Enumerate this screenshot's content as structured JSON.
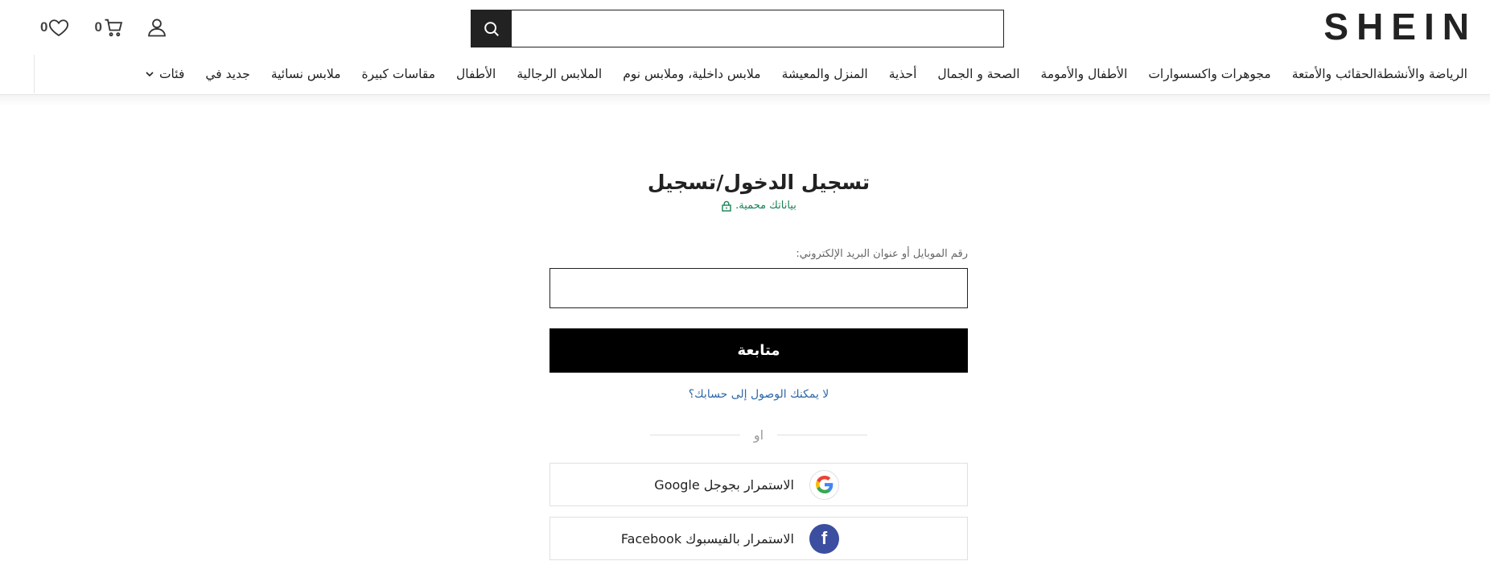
{
  "header": {
    "logo": "SHEIN",
    "search": {
      "placeholder": "",
      "value": ""
    },
    "wishlist_count": "0",
    "cart_count": "0"
  },
  "nav": {
    "items": [
      "فئات",
      "جديد في",
      "ملابس نسائية",
      "مقاسات كبيرة",
      "الأطفال",
      "الملابس الرجالية",
      "ملابس داخلية، وملابس نوم",
      "المنزل والمعيشة",
      "أحذية",
      "الصحة و الجمال",
      "الأطفال والأمومة",
      "مجوهرات واكسسوارات",
      "الحقائب والأمتعة",
      "الرياضة والأنشطة"
    ]
  },
  "login": {
    "title": "تسجيل الدخول/تسجيل",
    "secure_text": "بياناتك محمية.",
    "field_label": "رقم الموبايل أو عنوان البريد الإلكتروني:",
    "field_value": "",
    "continue_label": "متابعة",
    "help_link": "لا يمكنك الوصول إلى حسابك؟",
    "or_text": "او",
    "google_label": "الاستمرار بجوجل Google",
    "facebook_label": "الاستمرار بالفيسبوك Facebook"
  },
  "colors": {
    "secure_green": "#198055",
    "link_blue": "#2d68a8",
    "facebook_blue": "#3b4ea0",
    "button_black": "#000000"
  }
}
